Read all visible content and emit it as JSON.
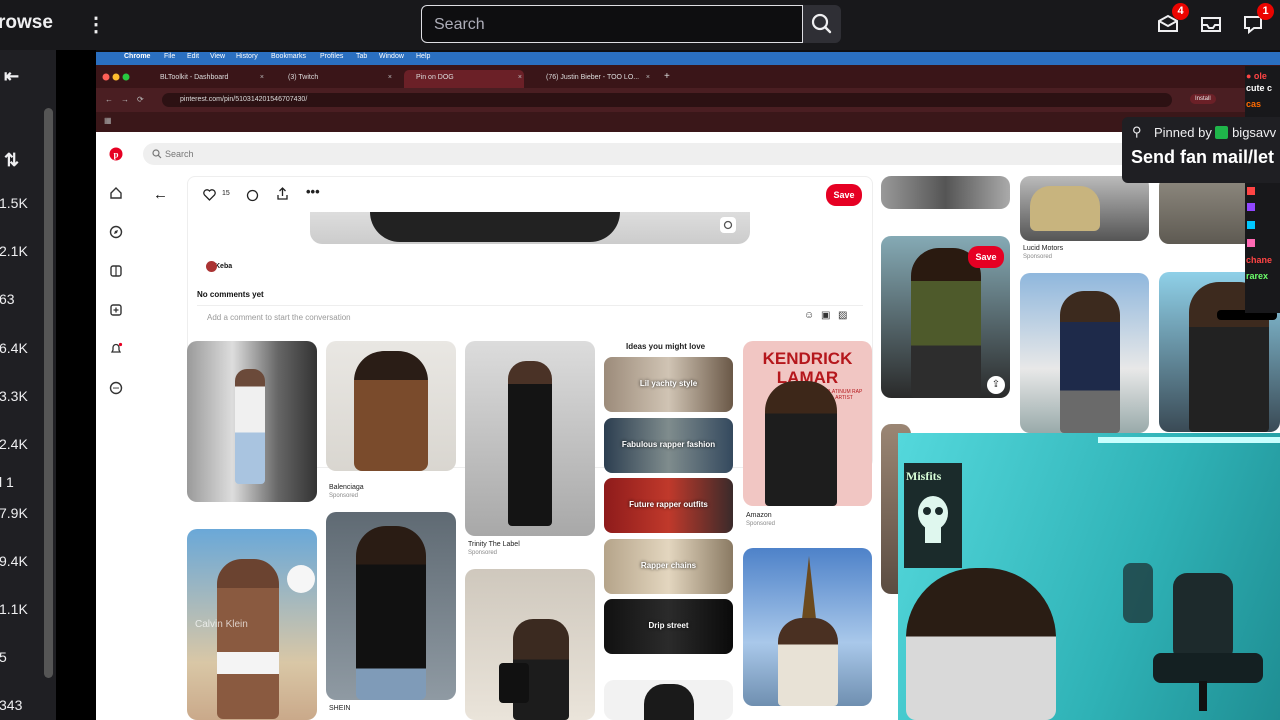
{
  "twitch": {
    "browse_label": "rowse",
    "search_placeholder": "Search",
    "inbox_badge": "4",
    "whisper_badge": "1",
    "sidebar_counts": [
      "1.5K",
      "2.1K",
      "63",
      "6.4K",
      "3.3K",
      "2.4K",
      "l 1",
      "7.9K",
      "9.4K",
      "1.1K",
      "5",
      "343"
    ]
  },
  "browser": {
    "menu_items": [
      "Chrome",
      "File",
      "Edit",
      "View",
      "History",
      "Bookmarks",
      "Profiles",
      "Tab",
      "Window",
      "Help"
    ],
    "tabs": [
      "BLToolkit - Dashboard",
      "(3) Twitch",
      "Pin on DOG",
      "(76) Justin Bieber - TOO LO..."
    ],
    "url": "pinterest.com/pin/510314201546707430/",
    "install_label": "Install"
  },
  "pinterest": {
    "search_placeholder": "Search",
    "like_count": "15",
    "save_label": "Save",
    "author": "Keba",
    "no_comments": "No comments yet",
    "comment_placeholder": "Add a comment to start the conversation",
    "ideas_title": "Ideas you might love",
    "ideas": [
      "Lil yachty style",
      "Fabulous rapper fashion",
      "Future rapper outfits",
      "Rapper chains",
      "Drip street"
    ],
    "captions": {
      "balenciaga": "Balenciaga",
      "trinity": "Trinity The Label",
      "amazon": "Amazon",
      "shein": "SHEIN",
      "lucid": "Lucid Motors",
      "sponsored": "Sponsored"
    },
    "kendrick_line1": "KENDRICK",
    "kendrick_line2": "LAMAR",
    "kendrick_tag": "PLATINUM RAP ARTIST",
    "calvin": "Calvin Klein"
  },
  "chat": {
    "pinned_by": "Pinned by",
    "pinned_user": "bigsavv",
    "pinned_message": "Send fan mail/let",
    "snippets": [
      "cute c",
      "cas"
    ],
    "colors": [
      "#ff4444",
      "#9147ff",
      "#00c8ff",
      "#ff69b4",
      "#6bff6b"
    ]
  },
  "webcam": {
    "poster_text": "Misfits"
  }
}
